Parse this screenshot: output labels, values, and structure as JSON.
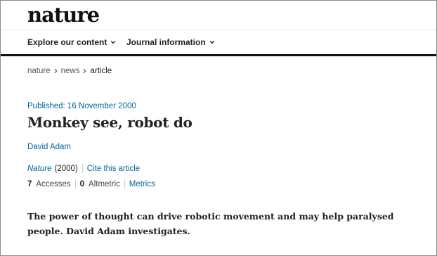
{
  "brand": {
    "logo": "nature"
  },
  "nav": {
    "items": [
      {
        "label": "Explore our content"
      },
      {
        "label": "Journal information"
      }
    ]
  },
  "breadcrumb": {
    "items": [
      "nature",
      "news",
      "article"
    ]
  },
  "article": {
    "published_label": "Published:",
    "published_date": "16 November 2000",
    "title": "Monkey see, robot do",
    "author": "David Adam",
    "journal": "Nature",
    "year": "(2000)",
    "cite_label": "Cite this article",
    "accesses_count": "7",
    "accesses_label": "Accesses",
    "altmetric_count": "0",
    "altmetric_label": "Altmetric",
    "metrics_label": "Metrics",
    "standfirst": "The power of thought can drive robotic movement and may help paralysed people. David Adam investigates."
  },
  "colors": {
    "link": "#006699",
    "text": "#222222",
    "rule": "#111111"
  },
  "icons": [
    "chevron-down-icon",
    "chevron-right-icon"
  ]
}
